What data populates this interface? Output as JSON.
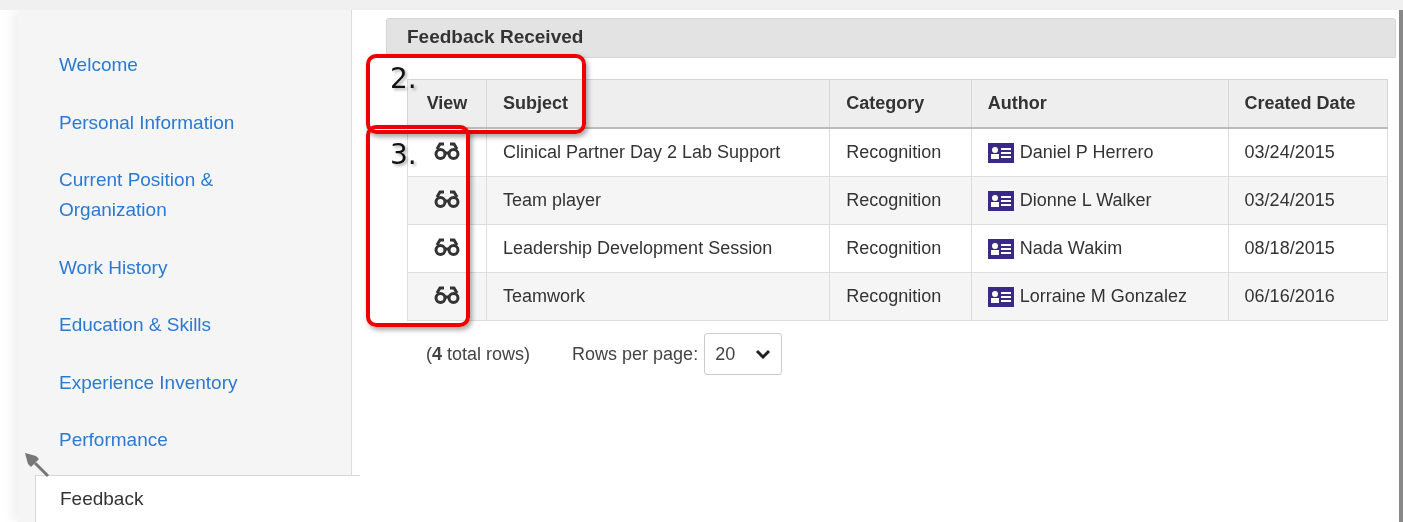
{
  "sidebar": {
    "items": [
      {
        "label": "Welcome",
        "selected": false
      },
      {
        "label": "Personal Information",
        "selected": false
      },
      {
        "label": "Current Position & Organization",
        "selected": false
      },
      {
        "label": "Work History",
        "selected": false
      },
      {
        "label": "Education & Skills",
        "selected": false
      },
      {
        "label": "Experience Inventory",
        "selected": false
      },
      {
        "label": "Performance",
        "selected": false
      },
      {
        "label": "Feedback",
        "selected": true
      }
    ]
  },
  "panel": {
    "title": "Feedback Received",
    "table": {
      "columns": [
        "View",
        "Subject",
        "Category",
        "Author",
        "Created Date"
      ],
      "rows": [
        {
          "subject": "Clinical Partner Day 2 Lab Support",
          "category": "Recognition",
          "author": "Daniel P Herrero",
          "created_date": "03/24/2015"
        },
        {
          "subject": "Team player",
          "category": "Recognition",
          "author": "Dionne L Walker",
          "created_date": "03/24/2015"
        },
        {
          "subject": "Leadership Development Session",
          "category": "Recognition",
          "author": "Nada Wakim",
          "created_date": "08/18/2015"
        },
        {
          "subject": "Teamwork",
          "category": "Recognition",
          "author": "Lorraine M Gonzalez",
          "created_date": "06/16/2016"
        }
      ]
    },
    "footer": {
      "total_count": "4",
      "total_text": "total rows)",
      "total_open": "(",
      "rows_per_page_label": "Rows per page:",
      "rows_per_page_value": "20"
    }
  },
  "annotations": [
    {
      "label": "2."
    },
    {
      "label": "3."
    }
  ]
}
